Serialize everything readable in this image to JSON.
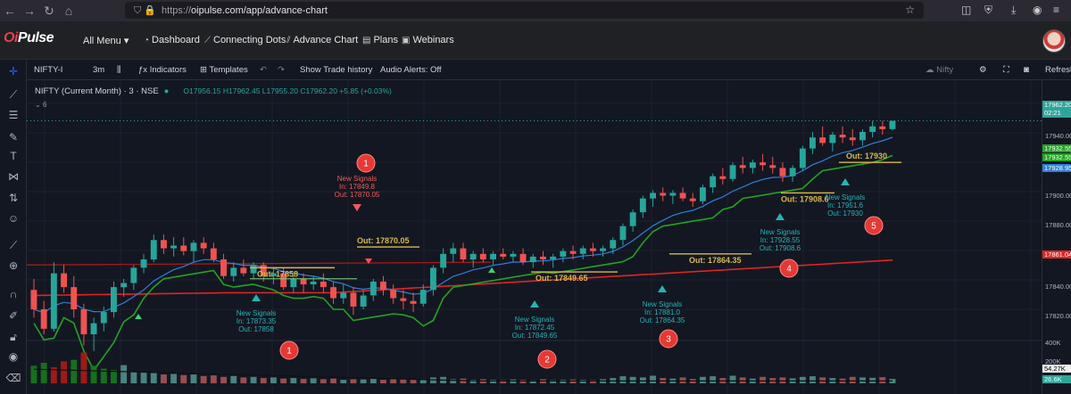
{
  "browser": {
    "url_prefix": "https://",
    "url": "oipulse.com/app/advance-chart"
  },
  "site": {
    "logo_left": "Oi",
    "logo_right": "Pulse",
    "all_menu": "All Menu",
    "nav": [
      "Dashboard",
      "Connecting Dots",
      "Advance Chart",
      "Plans",
      "Webinars"
    ]
  },
  "toolbar": {
    "symbol": "NIFTY-I",
    "interval": "3m",
    "indicators": "Indicators",
    "templates": "Templates",
    "trade_history": "Show Trade history",
    "audio_alerts": "Audio Alerts: Off",
    "compare": "Nifty",
    "refresh": "Refresh"
  },
  "legend": {
    "title": "NIFTY (Current Month) · 3 · NSE",
    "ohlc": "O17956.15 H17962.45 L17955.20 C17962.20 +5.85 (+0.03%)",
    "study": "6"
  },
  "colors": {
    "up": "#26a69a",
    "down": "#ef5350",
    "entry_line": "#7cd67c",
    "target_line": "#d8b94a",
    "ema_red": "#e02424",
    "blue_line": "#2f7fd8",
    "green_line": "#22a322",
    "annotation_cyan": "#24b3b3",
    "annotation_red": "#f25a5a",
    "marker_red": "#e53935"
  },
  "price_axis": {
    "ticks": [
      "17940.00",
      "17920.00",
      "17900.00",
      "17880.00",
      "17860.00",
      "17840.00",
      "17820.00"
    ],
    "current_price": "17962.20",
    "current_time": "02:21",
    "tag_green_1": "17932.55",
    "tag_green_2": "17932.55",
    "tag_blue": "17928.95",
    "tag_red": "17861.04",
    "volume_ticks": [
      "400K",
      "200K"
    ],
    "vol_tag_1": "54.27K",
    "vol_tag_2": "26.6K"
  },
  "chart_data": {
    "type": "candlestick",
    "price_range": [
      17808,
      17972
    ],
    "candles": [
      [
        17840,
        17848,
        17820,
        17826
      ],
      [
        17826,
        17832,
        17808,
        17812
      ],
      [
        17812,
        17860,
        17810,
        17852
      ],
      [
        17852,
        17858,
        17838,
        17842
      ],
      [
        17842,
        17850,
        17820,
        17826
      ],
      [
        17826,
        17830,
        17800,
        17808
      ],
      [
        17808,
        17820,
        17796,
        17816
      ],
      [
        17816,
        17828,
        17810,
        17824
      ],
      [
        17824,
        17846,
        17820,
        17842
      ],
      [
        17842,
        17848,
        17835,
        17845
      ],
      [
        17845,
        17858,
        17840,
        17856
      ],
      [
        17856,
        17866,
        17852,
        17862
      ],
      [
        17862,
        17880,
        17860,
        17876
      ],
      [
        17876,
        17880,
        17866,
        17870
      ],
      [
        17870,
        17878,
        17864,
        17872
      ],
      [
        17872,
        17878,
        17865,
        17868
      ],
      [
        17868,
        17876,
        17860,
        17874
      ],
      [
        17874,
        17878,
        17866,
        17870
      ],
      [
        17870,
        17874,
        17860,
        17862
      ],
      [
        17862,
        17866,
        17848,
        17850
      ],
      [
        17850,
        17860,
        17846,
        17856
      ],
      [
        17856,
        17862,
        17850,
        17852
      ],
      [
        17852,
        17860,
        17848,
        17858
      ],
      [
        17858,
        17860,
        17846,
        17850
      ],
      [
        17850,
        17856,
        17844,
        17852
      ],
      [
        17852,
        17856,
        17840,
        17842
      ],
      [
        17842,
        17850,
        17838,
        17848
      ],
      [
        17848,
        17852,
        17838,
        17844
      ],
      [
        17844,
        17850,
        17840,
        17846
      ],
      [
        17846,
        17852,
        17838,
        17842
      ],
      [
        17842,
        17846,
        17830,
        17834
      ],
      [
        17834,
        17844,
        17830,
        17838
      ],
      [
        17838,
        17842,
        17822,
        17828
      ],
      [
        17828,
        17840,
        17826,
        17836
      ],
      [
        17836,
        17848,
        17832,
        17846
      ],
      [
        17846,
        17850,
        17836,
        17840
      ],
      [
        17840,
        17844,
        17830,
        17834
      ],
      [
        17834,
        17840,
        17826,
        17832
      ],
      [
        17832,
        17838,
        17824,
        17830
      ],
      [
        17830,
        17844,
        17828,
        17840
      ],
      [
        17840,
        17858,
        17836,
        17856
      ],
      [
        17856,
        17870,
        17852,
        17866
      ],
      [
        17866,
        17874,
        17860,
        17870
      ],
      [
        17870,
        17874,
        17860,
        17862
      ],
      [
        17862,
        17868,
        17856,
        17866
      ],
      [
        17866,
        17870,
        17860,
        17862
      ],
      [
        17862,
        17868,
        17858,
        17866
      ],
      [
        17866,
        17870,
        17862,
        17864
      ],
      [
        17864,
        17868,
        17860,
        17866
      ],
      [
        17866,
        17870,
        17858,
        17860
      ],
      [
        17860,
        17866,
        17856,
        17864
      ],
      [
        17864,
        17868,
        17858,
        17862
      ],
      [
        17862,
        17866,
        17856,
        17864
      ],
      [
        17864,
        17870,
        17860,
        17868
      ],
      [
        17868,
        17872,
        17862,
        17866
      ],
      [
        17866,
        17872,
        17862,
        17870
      ],
      [
        17870,
        17874,
        17864,
        17868
      ],
      [
        17868,
        17872,
        17864,
        17870
      ],
      [
        17870,
        17878,
        17866,
        17876
      ],
      [
        17876,
        17888,
        17872,
        17886
      ],
      [
        17886,
        17898,
        17882,
        17896
      ],
      [
        17896,
        17908,
        17892,
        17906
      ],
      [
        17906,
        17912,
        17900,
        17910
      ],
      [
        17910,
        17914,
        17904,
        17908
      ],
      [
        17908,
        17912,
        17902,
        17910
      ],
      [
        17910,
        17914,
        17904,
        17906
      ],
      [
        17906,
        17910,
        17900,
        17904
      ],
      [
        17904,
        17916,
        17902,
        17914
      ],
      [
        17914,
        17924,
        17910,
        17922
      ],
      [
        17922,
        17928,
        17916,
        17920
      ],
      [
        17920,
        17932,
        17918,
        17930
      ],
      [
        17930,
        17936,
        17924,
        17928
      ],
      [
        17928,
        17934,
        17924,
        17932
      ],
      [
        17932,
        17938,
        17926,
        17930
      ],
      [
        17930,
        17936,
        17924,
        17928
      ],
      [
        17928,
        17932,
        17918,
        17922
      ],
      [
        17922,
        17930,
        17918,
        17928
      ],
      [
        17928,
        17944,
        17926,
        17942
      ],
      [
        17942,
        17954,
        17938,
        17950
      ],
      [
        17950,
        17958,
        17944,
        17946
      ],
      [
        17946,
        17954,
        17940,
        17952
      ],
      [
        17952,
        17958,
        17946,
        17950
      ],
      [
        17950,
        17956,
        17944,
        17948
      ],
      [
        17948,
        17956,
        17944,
        17954
      ],
      [
        17954,
        17962,
        17950,
        17958
      ],
      [
        17958,
        17962,
        17952,
        17956
      ],
      [
        17956,
        17962,
        17955,
        17962
      ]
    ],
    "volume_range": [
      0,
      400000
    ],
    "volumes": [
      60,
      70,
      55,
      75,
      80,
      105,
      60,
      50,
      45,
      62,
      40,
      38,
      35,
      30,
      32,
      28,
      30,
      25,
      27,
      22,
      25,
      20,
      22,
      18,
      20,
      16,
      18,
      15,
      17,
      14,
      16,
      12,
      14,
      13,
      15,
      12,
      14,
      13,
      12,
      11,
      20,
      22,
      14,
      16,
      12,
      14,
      12,
      11,
      13,
      12,
      10,
      14,
      11,
      12,
      13,
      12,
      11,
      14,
      18,
      24,
      22,
      20,
      26,
      18,
      16,
      20,
      15,
      22,
      24,
      18,
      26,
      20,
      16,
      22,
      18,
      20,
      17,
      22,
      24,
      20,
      18,
      16,
      22,
      20,
      19,
      21,
      15
    ],
    "annotations": {
      "signal_1": {
        "label": "New Signals",
        "in": "In: 17849.8",
        "out": "Out: 17870.05"
      },
      "signal_2": {
        "label": "New Signals",
        "in": "In: 17873.35",
        "out": "Out: 17858"
      },
      "signal_3": {
        "label": "New Signals",
        "in": "In: 17872.45",
        "out": "Out: 17849.65"
      },
      "signal_4": {
        "label": "New Signals",
        "in": "In: 17881.0",
        "out": "Out: 17864.35"
      },
      "signal_5": {
        "label": "New Signals",
        "in": "In: 17928.55",
        "out": "Out: 17908.6"
      },
      "signal_6": {
        "label": "New Signals",
        "in": "In: 17951.6",
        "out": "Out: 17930"
      },
      "out_labels": [
        "Out: 17858",
        "Out: 17870.05",
        "Out: 17849.65",
        "Out: 17864.35",
        "Out: 17908.6",
        "Out: 17930"
      ],
      "markers": [
        "1",
        "2",
        "3",
        "4",
        "5",
        "1"
      ]
    }
  }
}
